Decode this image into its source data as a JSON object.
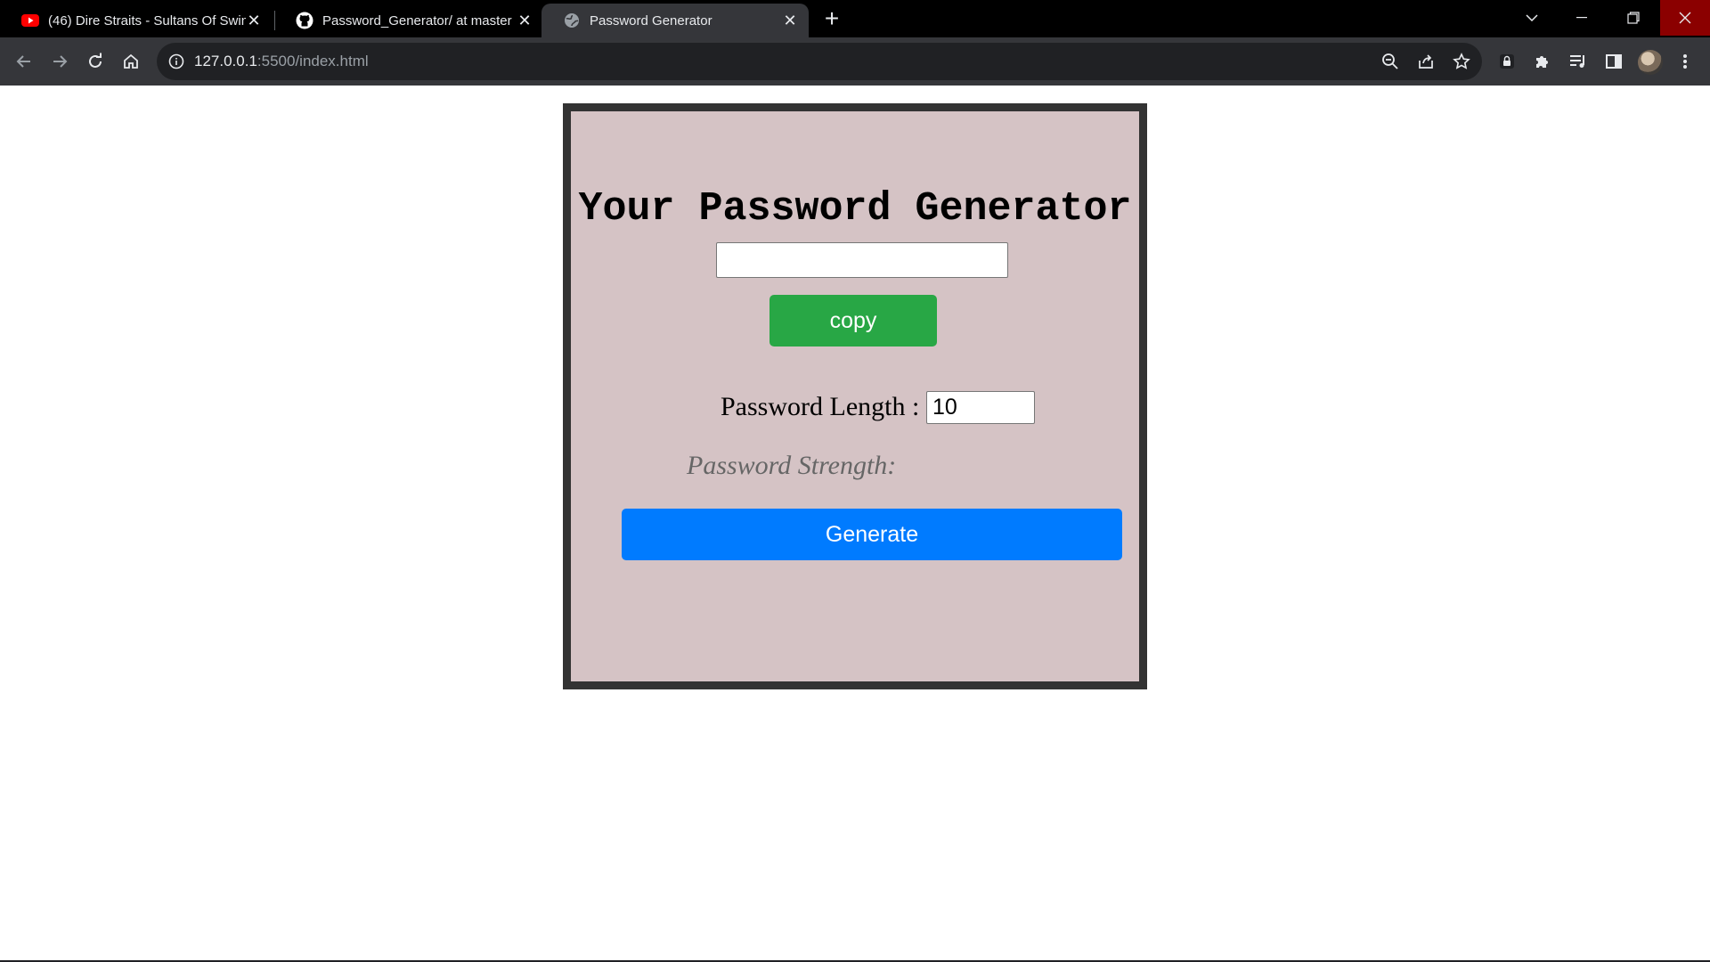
{
  "browser": {
    "tabs": [
      {
        "title": "(46) Dire Straits - Sultans Of Swin",
        "favicon": "youtube-icon",
        "active": false
      },
      {
        "title": "Password_Generator/ at master ·",
        "favicon": "github-icon",
        "active": false
      },
      {
        "title": "Password Generator",
        "favicon": "globe-icon",
        "active": true
      }
    ],
    "url_host": "127.0.0.1",
    "url_rest": ":5500/index.html"
  },
  "app": {
    "title": "Your Password Generator",
    "password_value": "",
    "copy_label": "copy",
    "length_label": "Password Length :",
    "length_value": "10",
    "strength_label": "Password Strength:",
    "generate_label": "Generate"
  },
  "colors": {
    "card_bg": "#d5c3c5",
    "card_border": "#333333",
    "copy_button": "#28a745",
    "generate_button": "#007bff"
  }
}
